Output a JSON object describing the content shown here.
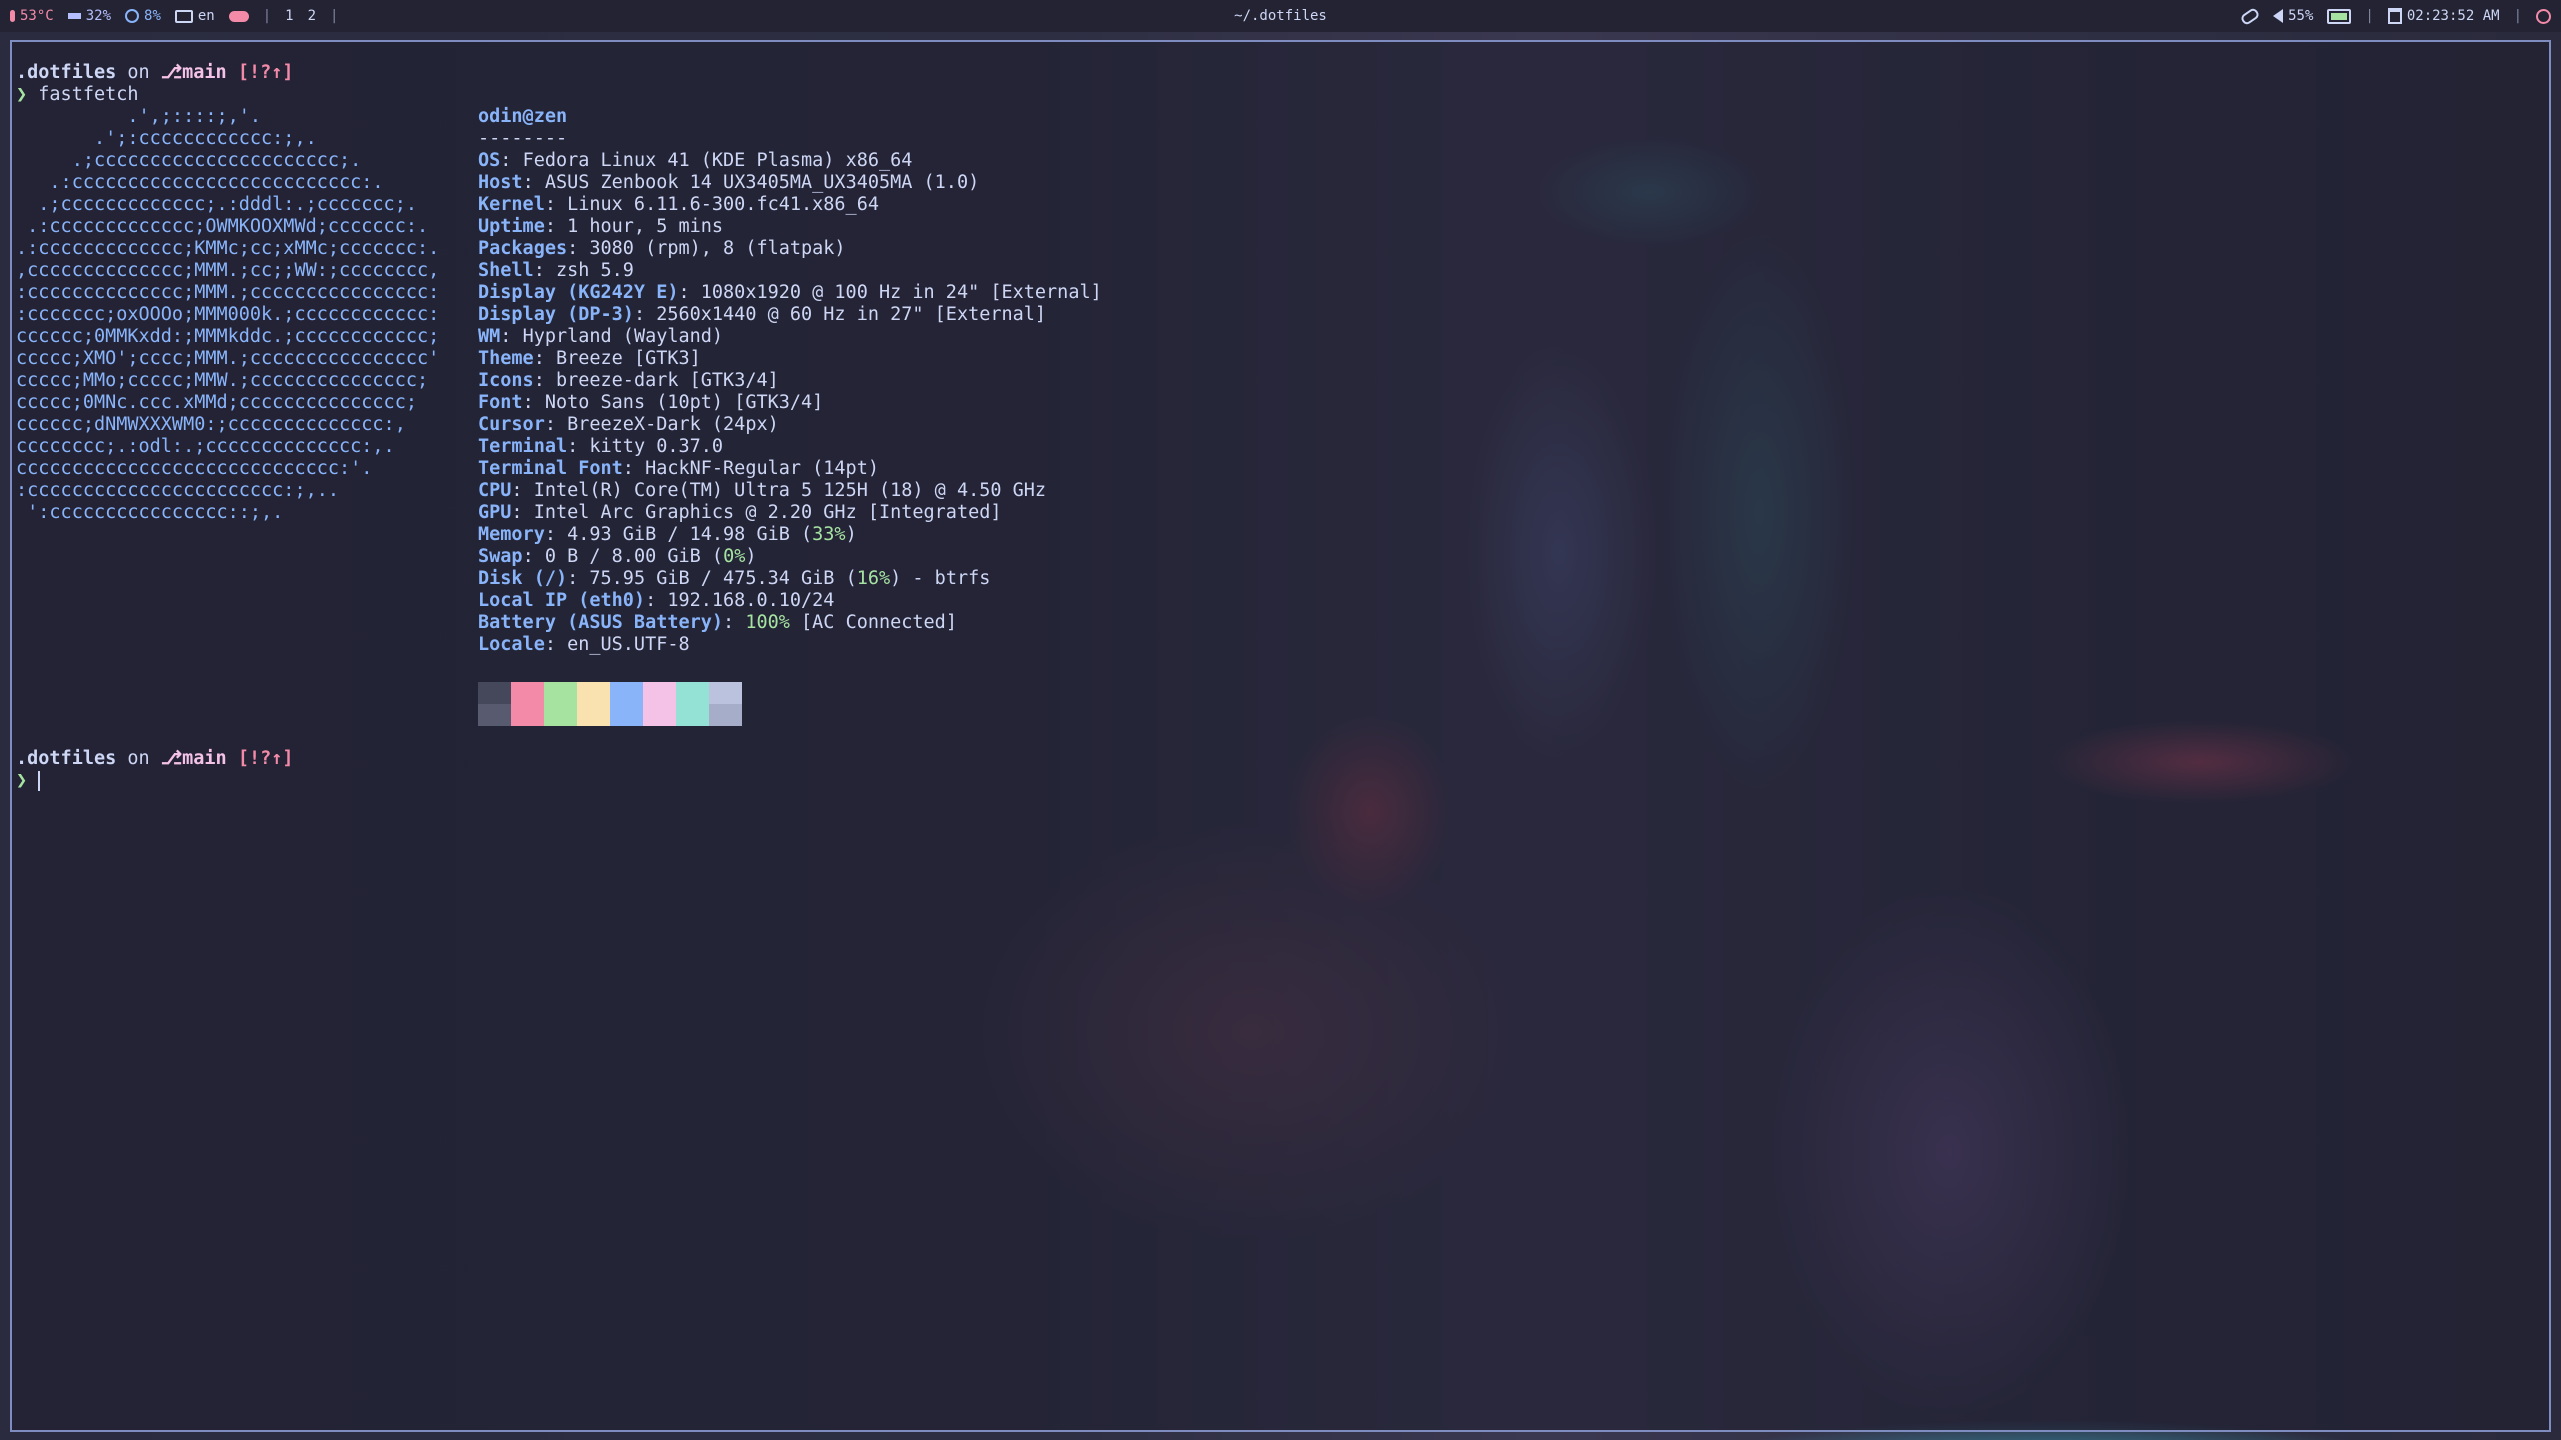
{
  "topbar": {
    "left": {
      "temp": "53°C",
      "mem": "32%",
      "cpu": "8%",
      "lang": "en",
      "ws1": "1",
      "ws2": "2"
    },
    "title": "~/.dotfiles",
    "right": {
      "volume": "55%",
      "clock": "02:23:52 AM"
    }
  },
  "terminal": {
    "prompt": {
      "dir": ".dotfiles",
      "on": "on",
      "branch_icon": "⎇",
      "branch": "main",
      "status": "[!?↑]",
      "arrow": "❯"
    },
    "command": "fastfetch",
    "logo_lines": [
      "          .',;::::;,'.",
      "       .';:cccccccccccc:;,.",
      "     .;cccccccccccccccccccccc;.",
      "   .:cccccccccccccccccccccccccc:.",
      "  .;ccccccccccccc;.:dddl:.;ccccccc;.",
      " .:ccccccccccccc;OWMKOOXMWd;ccccccc:.",
      ".:ccccccccccccc;KMMc;cc;xMMc;ccccccc:.",
      ",cccccccccccccc;MMM.;cc;;WW:;cccccccc,",
      ":cccccccccccccc;MMM.;cccccccccccccccc:",
      ":ccccccc;oxOOOo;MMM000k.;cccccccccccc:",
      "cccccc;0MMKxdd:;MMMkddc.;cccccccccccc;",
      "ccccc;XMO';cccc;MMM.;cccccccccccccccc'",
      "ccccc;MMo;ccccc;MMW.;ccccccccccccccc;",
      "ccccc;0MNc.ccc.xMMd;ccccccccccccccc;",
      "cccccc;dNMWXXXWM0:;cccccccccccccc:,",
      "cccccccc;.:odl:.;cccccccccccccc:,.",
      "ccccccccccccccccccccccccccccc:'.",
      ":ccccccccccccccccccccccc:;,..",
      " ':cccccccccccccccc::;,."
    ],
    "info": {
      "title": "odin@zen",
      "separator": "--------",
      "rows": [
        {
          "k": "OS",
          "v": "Fedora Linux 41 (KDE Plasma) x86_64"
        },
        {
          "k": "Host",
          "v": "ASUS Zenbook 14 UX3405MA_UX3405MA (1.0)"
        },
        {
          "k": "Kernel",
          "v": "Linux 6.11.6-300.fc41.x86_64"
        },
        {
          "k": "Uptime",
          "v": "1 hour, 5 mins"
        },
        {
          "k": "Packages",
          "v": "3080 (rpm), 8 (flatpak)"
        },
        {
          "k": "Shell",
          "v": "zsh 5.9"
        },
        {
          "k": "Display (KG242Y E)",
          "v": "1080x1920 @ 100 Hz in 24\" [External]"
        },
        {
          "k": "Display (DP-3)",
          "v": "2560x1440 @ 60 Hz in 27\" [External]"
        },
        {
          "k": "WM",
          "v": "Hyprland (Wayland)"
        },
        {
          "k": "Theme",
          "v": "Breeze [GTK3]"
        },
        {
          "k": "Icons",
          "v": "breeze-dark [GTK3/4]"
        },
        {
          "k": "Font",
          "v": "Noto Sans (10pt) [GTK3/4]"
        },
        {
          "k": "Cursor",
          "v": "BreezeX-Dark (24px)"
        },
        {
          "k": "Terminal",
          "v": "kitty 0.37.0"
        },
        {
          "k": "Terminal Font",
          "v": "HackNF-Regular (14pt)"
        },
        {
          "k": "CPU",
          "v": "Intel(R) Core(TM) Ultra 5 125H (18) @ 4.50 GHz"
        },
        {
          "k": "GPU",
          "v": "Intel Arc Graphics @ 2.20 GHz [Integrated]"
        },
        {
          "k": "Memory",
          "v": "4.93 GiB / 14.98 GiB (",
          "pct": "33%",
          "tail": ")"
        },
        {
          "k": "Swap",
          "v": "0 B / 8.00 GiB (",
          "pct": "0%",
          "tail": ")"
        },
        {
          "k": "Disk (/)",
          "v": "75.95 GiB / 475.34 GiB (",
          "pct": "16%",
          "tail": ") - btrfs"
        },
        {
          "k": "Local IP (eth0)",
          "v": "192.168.0.10/24"
        },
        {
          "k": "Battery (ASUS Battery)",
          "v": "",
          "pct": "100%",
          "tail": " [AC Connected]"
        },
        {
          "k": "Locale",
          "v": "en_US.UTF-8"
        }
      ]
    },
    "palette": [
      {
        "top": "#45475a",
        "bottom": "#585b70"
      },
      {
        "top": "#f38ba8",
        "bottom": "#f38ba8"
      },
      {
        "top": "#a6e3a1",
        "bottom": "#a6e3a1"
      },
      {
        "top": "#f9e2af",
        "bottom": "#f9e2af"
      },
      {
        "top": "#89b4fa",
        "bottom": "#89b4fa"
      },
      {
        "top": "#f5c2e7",
        "bottom": "#f5c2e7"
      },
      {
        "top": "#94e2d5",
        "bottom": "#94e2d5"
      },
      {
        "top": "#bac2de",
        "bottom": "#a6adc8"
      }
    ]
  }
}
